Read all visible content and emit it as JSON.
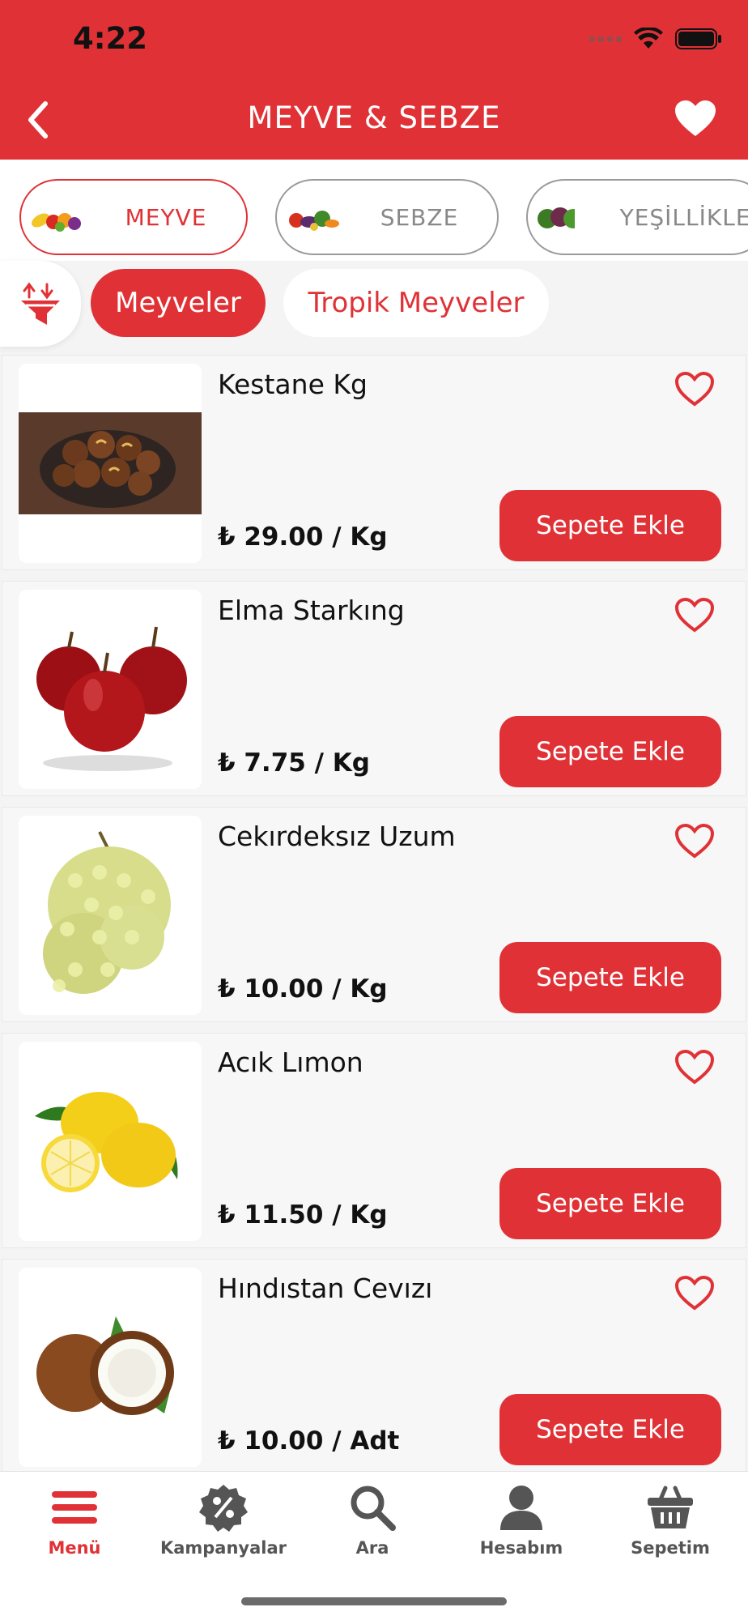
{
  "status_bar": {
    "time": "4:22"
  },
  "header": {
    "title": "MEYVE & SEBZE"
  },
  "categories": [
    {
      "label": "MEYVE",
      "active": true
    },
    {
      "label": "SEBZE",
      "active": false
    },
    {
      "label": "YEŞİLLİKLER",
      "active": false
    }
  ],
  "subcategories": [
    {
      "label": "Meyveler",
      "active": true
    },
    {
      "label": "Tropik Meyveler",
      "active": false
    }
  ],
  "products": [
    {
      "name": "Kestane Kg",
      "price": "₺ 29.00 / Kg",
      "button": "Sepete Ekle",
      "image": "chestnuts"
    },
    {
      "name": "Elma Starkıng",
      "price": "₺ 7.75 / Kg",
      "button": "Sepete Ekle",
      "image": "red-apples"
    },
    {
      "name": "Cekırdeksız Uzum",
      "price": "₺ 10.00 / Kg",
      "button": "Sepete Ekle",
      "image": "green-grapes"
    },
    {
      "name": "Acık Lımon",
      "price": "₺ 11.50 / Kg",
      "button": "Sepete Ekle",
      "image": "lemons"
    },
    {
      "name": "Hındıstan Cevızı",
      "price": "₺ 10.00 / Adt",
      "button": "Sepete Ekle",
      "image": "coconut"
    }
  ],
  "tabbar": [
    {
      "label": "Menü",
      "icon": "hamburger-icon",
      "active": true
    },
    {
      "label": "Kampanyalar",
      "icon": "percent-badge-icon",
      "active": false
    },
    {
      "label": "Ara",
      "icon": "search-icon",
      "active": false
    },
    {
      "label": "Hesabım",
      "icon": "user-icon",
      "active": false
    },
    {
      "label": "Sepetim",
      "icon": "basket-icon",
      "active": false
    }
  ],
  "colors": {
    "primary": "#e03236",
    "background": "#f4f4f4",
    "card": "#f7f7f7"
  }
}
